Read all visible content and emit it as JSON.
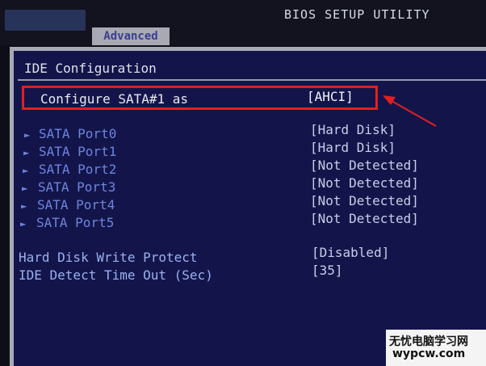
{
  "header": {
    "title": "BIOS SETUP UTILITY",
    "tab": "Advanced"
  },
  "section": {
    "title": "IDE Configuration"
  },
  "highlighted": {
    "label": "Configure SATA#1 as",
    "value": "[AHCI]"
  },
  "ports": [
    {
      "label": "SATA Port0",
      "value": "[Hard Disk]"
    },
    {
      "label": "SATA Port1",
      "value": "[Hard Disk]"
    },
    {
      "label": "SATA Port2",
      "value": "[Not Detected]"
    },
    {
      "label": "SATA Port3",
      "value": "[Not Detected]"
    },
    {
      "label": "SATA Port4",
      "value": "[Not Detected]"
    },
    {
      "label": "SATA Port5",
      "value": "[Not Detected]"
    }
  ],
  "options": [
    {
      "label": "Hard Disk Write Protect",
      "value": "[Disabled]"
    },
    {
      "label": "IDE Detect Time Out (Sec)",
      "value": "[35]"
    }
  ],
  "watermark": {
    "line1": "无忧电脑学习网",
    "line2": "wypcw.com"
  },
  "colors": {
    "highlight_box": "#e02020",
    "panel_bg": "#13154a",
    "port_label": "#6e84dc"
  }
}
